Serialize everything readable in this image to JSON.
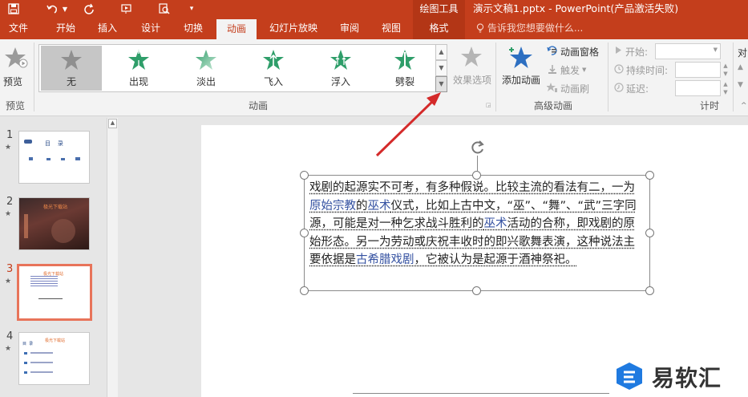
{
  "titlebar": {
    "drawing_tools": "绘图工具",
    "title": "演示文稿1.pptx - PowerPoint(产品激活失败)"
  },
  "tabs": [
    "文件",
    "开始",
    "插入",
    "设计",
    "切换",
    "动画",
    "幻灯片放映",
    "审阅",
    "视图",
    "格式"
  ],
  "tell_me": "告诉我您想要做什么...",
  "ribbon": {
    "preview": {
      "label": "预览",
      "group": "预览"
    },
    "animation_group": "动画",
    "gallery": [
      {
        "label": "无"
      },
      {
        "label": "出现"
      },
      {
        "label": "淡出"
      },
      {
        "label": "飞入"
      },
      {
        "label": "浮入"
      },
      {
        "label": "劈裂"
      }
    ],
    "effect_options": "效果选项",
    "advanced": {
      "group": "高级动画",
      "add_animation": "添加动画",
      "animation_pane": "动画窗格",
      "trigger": "触发",
      "animation_painter": "动画刷"
    },
    "timing": {
      "group": "计时",
      "start": "开始:",
      "duration": "持续时间:",
      "delay": "延迟:",
      "reorder": "对"
    }
  },
  "slides": [
    {
      "number": "1",
      "star": "★",
      "title": "目    录"
    },
    {
      "number": "2",
      "star": "★",
      "title": "极光下载站"
    },
    {
      "number": "3",
      "star": "★",
      "title": "极光下载站"
    },
    {
      "number": "4",
      "star": "★",
      "title": "极光下载站",
      "subtitle": "目  录"
    }
  ],
  "textbox": {
    "p1": "戏剧的起源实不可考，有多种假说。比较主流的看法有二，一为",
    "p1_link1": "原始宗教",
    "p1_mid": "的",
    "p1_link2": "巫术",
    "p1_rest": "仪式，比如上古中文，“巫”、“舞”、“武”三字同源，可能是对一种乞求战斗胜利的",
    "p1_link3": "巫术",
    "p1_end": "活动的合称，即戏剧的原始形态。另一为劳动或庆祝丰收时的即兴歌舞表演，这种说法主要依据是",
    "p1_link4": "古希腊戏剧",
    "p1_tail": "，它被认为是起源于酒神祭祀。"
  },
  "watermark": "易软汇",
  "colors": {
    "accent": "#c43e1c",
    "thumb_selected": "#e8745a",
    "star_green": "#3aa36b"
  }
}
